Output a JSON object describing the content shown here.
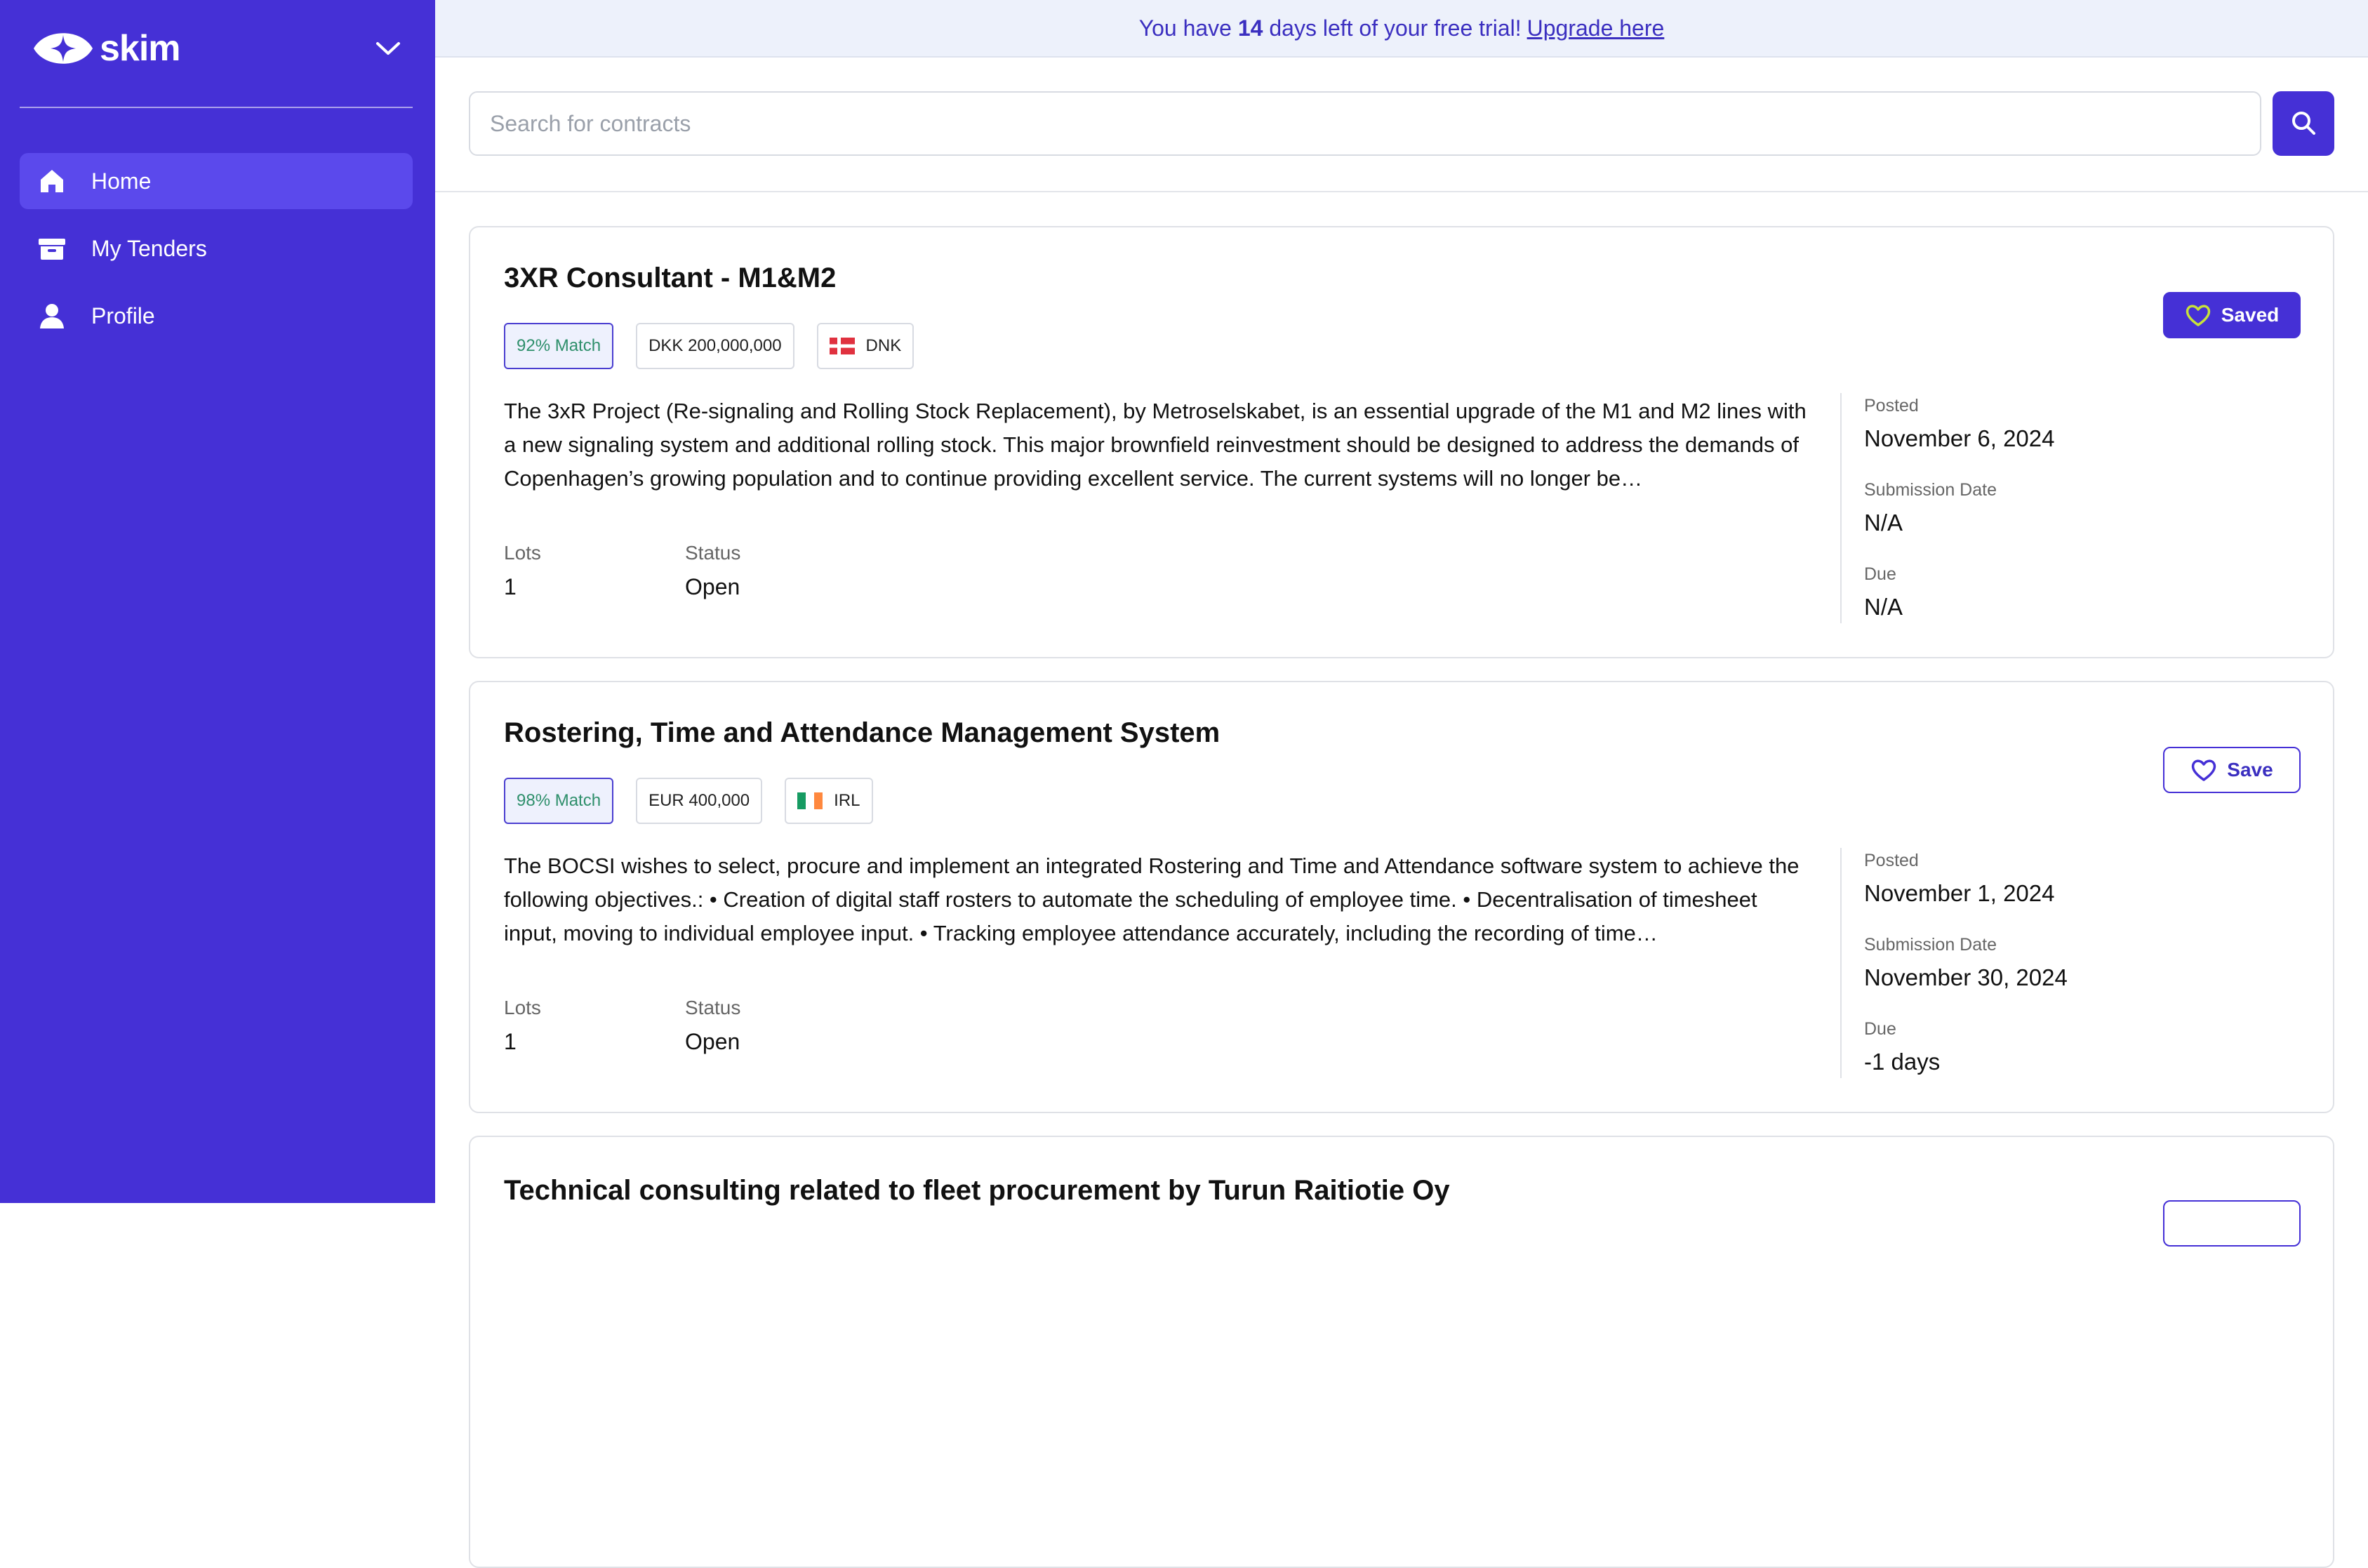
{
  "app": {
    "logo_text": "skim"
  },
  "sidebar": {
    "items": [
      {
        "label": "Home",
        "icon": "home-icon",
        "active": true
      },
      {
        "label": "My Tenders",
        "icon": "archive-icon",
        "active": false
      },
      {
        "label": "Profile",
        "icon": "user-icon",
        "active": false
      }
    ]
  },
  "banner": {
    "prefix": "You have",
    "days": "14",
    "suffix": "days left of your free trial!",
    "link": "Upgrade here"
  },
  "search": {
    "placeholder": "Search for contracts",
    "value": ""
  },
  "labels": {
    "lots": "Lots",
    "status": "Status",
    "posted": "Posted",
    "submission_date": "Submission Date",
    "due": "Due"
  },
  "cards": [
    {
      "title": "3XR Consultant - M1&M2",
      "match": "92% Match",
      "value": "DKK 200,000,000",
      "country": "DNK",
      "description": "The 3xR Project (Re-signaling and Rolling Stock Replacement), by Metroselskabet, is an essential upgrade of the M1 and M2 lines with a new signaling system and additional rolling stock. This major brownfield reinvestment should be designed to address the demands of Copenhagen’s growing population and to continue providing excellent service. The current systems will no longer be…",
      "lots": "1",
      "status": "Open",
      "posted": "November 6, 2024",
      "submission_date": "N/A",
      "due": "N/A",
      "save_label": "Saved"
    },
    {
      "title": "Rostering, Time and Attendance Management System",
      "match": "98% Match",
      "value": "EUR 400,000",
      "country": "IRL",
      "description": "The BOCSI wishes to select, procure and implement an integrated Rostering and Time and Attendance software system to achieve the following objectives.: • Creation of digital staff rosters to automate the scheduling of employee time. • Decentralisation of timesheet input, moving to individual employee input. • Tracking employee attendance accurately, including the recording of time…",
      "lots": "1",
      "status": "Open",
      "posted": "November 1, 2024",
      "submission_date": "November 30, 2024",
      "due": "-1 days",
      "save_label": "Save"
    },
    {
      "title": "Technical consulting related to fleet procurement by Turun Raitiotie Oy"
    }
  ],
  "colors": {
    "sidebar": "#4530d6",
    "nav_active": "#5b49ec",
    "banner_bg": "#edf1fb",
    "accent": "#4530d6",
    "match_text": "#2e8f6b"
  }
}
